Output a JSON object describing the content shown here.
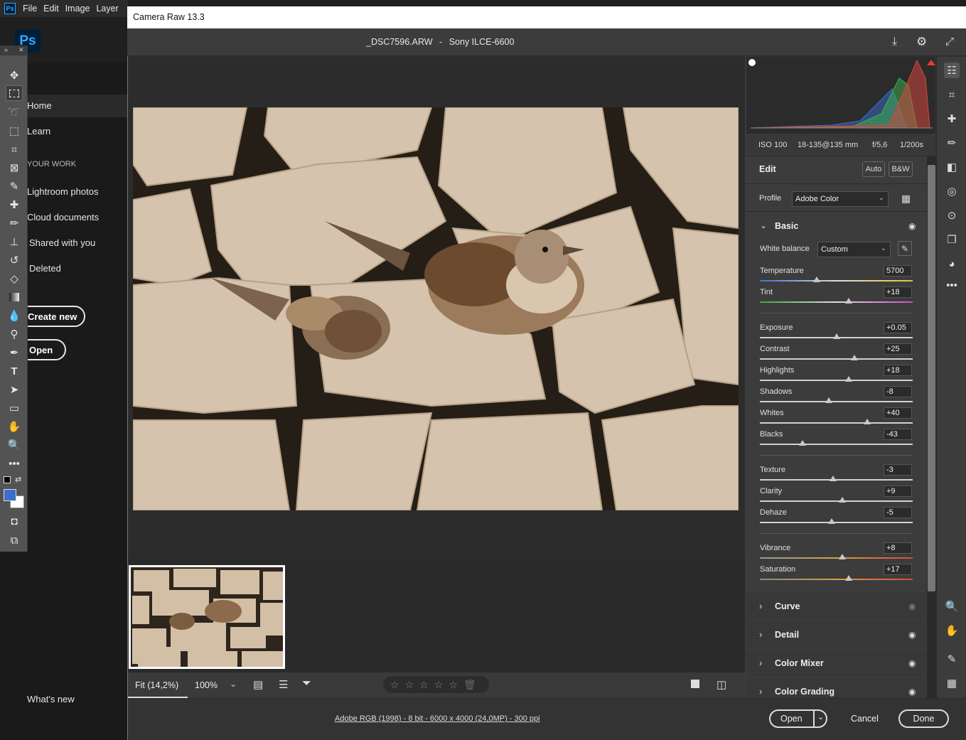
{
  "ps_menu": {
    "logo": "Ps",
    "items": [
      "File",
      "Edit",
      "Image",
      "Layer"
    ]
  },
  "ps_home": {
    "logo": "Ps",
    "nav": [
      "Home",
      "Learn"
    ],
    "section": "YOUR WORK",
    "work_items": [
      "Lightroom photos",
      "Cloud documents",
      "Shared with you",
      "Deleted"
    ],
    "create_new": "Create new",
    "open": "Open",
    "whats_new": "What's new"
  },
  "toolbar_tools": [
    "move-tool",
    "marquee-tool",
    "lasso-tool",
    "object-select-tool",
    "crop-tool",
    "frame-tool",
    "eyedropper-tool",
    "healing-tool",
    "brush-tool",
    "clone-stamp-tool",
    "history-brush-tool",
    "eraser-tool",
    "gradient-tool",
    "blur-tool",
    "dodge-tool",
    "pen-tool",
    "type-tool",
    "path-select-tool",
    "rectangle-tool",
    "hand-tool",
    "zoom-tool",
    "more-tools"
  ],
  "camera_raw": {
    "window_title": "Camera Raw 13.3",
    "file_name": "_DSC7596.ARW",
    "separator": "-",
    "camera": "Sony ILCE-6600",
    "exif": {
      "iso": "ISO 100",
      "lens": "18-135@135 mm",
      "aperture": "f/5,6",
      "shutter": "1/200s"
    },
    "edit": {
      "title": "Edit",
      "auto": "Auto",
      "bw": "B&W",
      "profile_label": "Profile",
      "profile_value": "Adobe Color"
    },
    "basic": {
      "title": "Basic",
      "white_balance_label": "White balance",
      "white_balance_value": "Custom",
      "sliders": [
        {
          "label": "Temperature",
          "value": "5700",
          "pos": 0.37
        },
        {
          "label": "Tint",
          "value": "+18",
          "pos": 0.58
        },
        {
          "label": "Exposure",
          "value": "+0.05",
          "pos": 0.5
        },
        {
          "label": "Contrast",
          "value": "+25",
          "pos": 0.62
        },
        {
          "label": "Highlights",
          "value": "+18",
          "pos": 0.58
        },
        {
          "label": "Shadows",
          "value": "-8",
          "pos": 0.45
        },
        {
          "label": "Whites",
          "value": "+40",
          "pos": 0.7
        },
        {
          "label": "Blacks",
          "value": "-43",
          "pos": 0.28
        },
        {
          "label": "Texture",
          "value": "-3",
          "pos": 0.48
        },
        {
          "label": "Clarity",
          "value": "+9",
          "pos": 0.54
        },
        {
          "label": "Dehaze",
          "value": "-5",
          "pos": 0.47
        },
        {
          "label": "Vibrance",
          "value": "+8",
          "pos": 0.54
        },
        {
          "label": "Saturation",
          "value": "+17",
          "pos": 0.58
        }
      ]
    },
    "panels": [
      "Curve",
      "Detail",
      "Color Mixer",
      "Color Grading"
    ],
    "zoom_fit": "Fit (14,2%)",
    "zoom_100": "100%",
    "workflow": "Adobe RGB (1998) - 8 bit - 6000 x 4000 (24,0MP) - 300 ppi",
    "buttons": {
      "open": "Open",
      "cancel": "Cancel",
      "done": "Done"
    }
  }
}
